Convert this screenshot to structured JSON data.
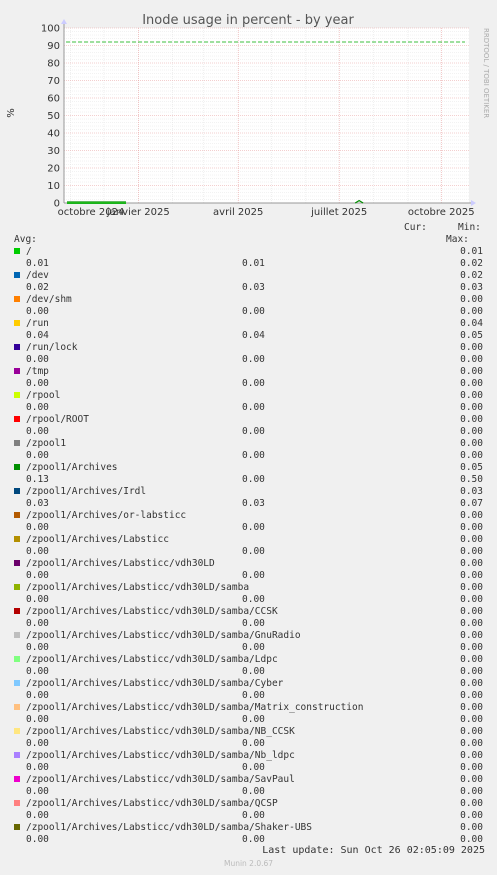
{
  "chart_data": {
    "type": "line",
    "title": "Inode usage in percent - by year",
    "ylabel": "%",
    "ylim": [
      0,
      100
    ],
    "y_ticks": [
      "0",
      "10",
      "20",
      "30",
      "40",
      "50",
      "60",
      "70",
      "80",
      "90",
      "100"
    ],
    "x_ticks": [
      "octobre 2024",
      "janvier 2025",
      "avril 2025",
      "juillet 2025",
      "octobre 2025"
    ],
    "x_range": [
      "2024-10-26",
      "2025-10-26"
    ],
    "threshold": 92,
    "grid": true,
    "side_label": "RRDTOOL / TOBI OETIKER",
    "header": {
      "cur": "Cur:",
      "min": "Min:",
      "avg": "Avg:",
      "max": "Max:"
    },
    "series": [
      {
        "name": "/",
        "color": "#00cc00",
        "cur": "0.01",
        "min": "0.01",
        "avg": "0.01",
        "max": "0.02"
      },
      {
        "name": "/dev",
        "color": "#0066b3",
        "cur": "0.02",
        "min": "0.03",
        "avg": "0.02",
        "max": "0.03"
      },
      {
        "name": "/dev/shm",
        "color": "#ff8000",
        "cur": "0.00",
        "min": "0.00",
        "avg": "0.00",
        "max": "0.00"
      },
      {
        "name": "/run",
        "color": "#ffcc00",
        "cur": "0.04",
        "min": "0.04",
        "avg": "0.04",
        "max": "0.05"
      },
      {
        "name": "/run/lock",
        "color": "#330099",
        "cur": "0.00",
        "min": "0.00",
        "avg": "0.00",
        "max": "0.00"
      },
      {
        "name": "/tmp",
        "color": "#990099",
        "cur": "0.00",
        "min": "0.00",
        "avg": "0.00",
        "max": "0.00"
      },
      {
        "name": "/rpool",
        "color": "#ccff00",
        "cur": "0.00",
        "min": "0.00",
        "avg": "0.00",
        "max": "0.00"
      },
      {
        "name": "/rpool/ROOT",
        "color": "#ff0000",
        "cur": "0.00",
        "min": "0.00",
        "avg": "0.00",
        "max": "0.00"
      },
      {
        "name": "/zpool1",
        "color": "#808080",
        "cur": "0.00",
        "min": "0.00",
        "avg": "0.00",
        "max": "0.00"
      },
      {
        "name": "/zpool1/Archives",
        "color": "#008f00",
        "cur": "0.05",
        "min": "0.00",
        "avg": "0.13",
        "max": "0.50"
      },
      {
        "name": "/zpool1/Archives/Irdl",
        "color": "#00487d",
        "cur": "0.03",
        "min": "0.03",
        "avg": "0.03",
        "max": "0.07"
      },
      {
        "name": "/zpool1/Archives/or-labsticc",
        "color": "#b35a00",
        "cur": "0.00",
        "min": "0.00",
        "avg": "0.00",
        "max": "0.00"
      },
      {
        "name": "/zpool1/Archives/Labsticc",
        "color": "#b38f00",
        "cur": "0.00",
        "min": "0.00",
        "avg": "0.00",
        "max": "0.00"
      },
      {
        "name": "/zpool1/Archives/Labsticc/vdh30LD",
        "color": "#6b006b",
        "cur": "0.00",
        "min": "0.00",
        "avg": "0.00",
        "max": "0.00"
      },
      {
        "name": "/zpool1/Archives/Labsticc/vdh30LD/samba",
        "color": "#8fb300",
        "cur": "0.00",
        "min": "0.00",
        "avg": "0.00",
        "max": "0.00"
      },
      {
        "name": "/zpool1/Archives/Labsticc/vdh30LD/samba/CCSK",
        "color": "#b30000",
        "cur": "0.00",
        "min": "0.00",
        "avg": "0.00",
        "max": "0.00"
      },
      {
        "name": "/zpool1/Archives/Labsticc/vdh30LD/samba/GnuRadio",
        "color": "#bebebe",
        "cur": "0.00",
        "min": "0.00",
        "avg": "0.00",
        "max": "0.00"
      },
      {
        "name": "/zpool1/Archives/Labsticc/vdh30LD/samba/Ldpc",
        "color": "#80ff80",
        "cur": "0.00",
        "min": "0.00",
        "avg": "0.00",
        "max": "0.00"
      },
      {
        "name": "/zpool1/Archives/Labsticc/vdh30LD/samba/Cyber",
        "color": "#80c9ff",
        "cur": "0.00",
        "min": "0.00",
        "avg": "0.00",
        "max": "0.00"
      },
      {
        "name": "/zpool1/Archives/Labsticc/vdh30LD/samba/Matrix_construction",
        "color": "#ffc080",
        "cur": "0.00",
        "min": "0.00",
        "avg": "0.00",
        "max": "0.00"
      },
      {
        "name": "/zpool1/Archives/Labsticc/vdh30LD/samba/NB_CCSK",
        "color": "#ffe680",
        "cur": "0.00",
        "min": "0.00",
        "avg": "0.00",
        "max": "0.00"
      },
      {
        "name": "/zpool1/Archives/Labsticc/vdh30LD/samba/Nb_ldpc",
        "color": "#aa80ff",
        "cur": "0.00",
        "min": "0.00",
        "avg": "0.00",
        "max": "0.00"
      },
      {
        "name": "/zpool1/Archives/Labsticc/vdh30LD/samba/SavPaul",
        "color": "#ee00cc",
        "cur": "0.00",
        "min": "0.00",
        "avg": "0.00",
        "max": "0.00"
      },
      {
        "name": "/zpool1/Archives/Labsticc/vdh30LD/samba/QCSP",
        "color": "#ff8080",
        "cur": "0.00",
        "min": "0.00",
        "avg": "0.00",
        "max": "0.00"
      },
      {
        "name": "/zpool1/Archives/Labsticc/vdh30LD/samba/Shaker-UBS",
        "color": "#666600",
        "cur": "0.00",
        "min": "0.00",
        "avg": "0.00",
        "max": "0.00"
      }
    ]
  },
  "footer": {
    "last_update": "Last update: Sun Oct 26 02:05:09 2025",
    "version": "Munin 2.0.67"
  }
}
